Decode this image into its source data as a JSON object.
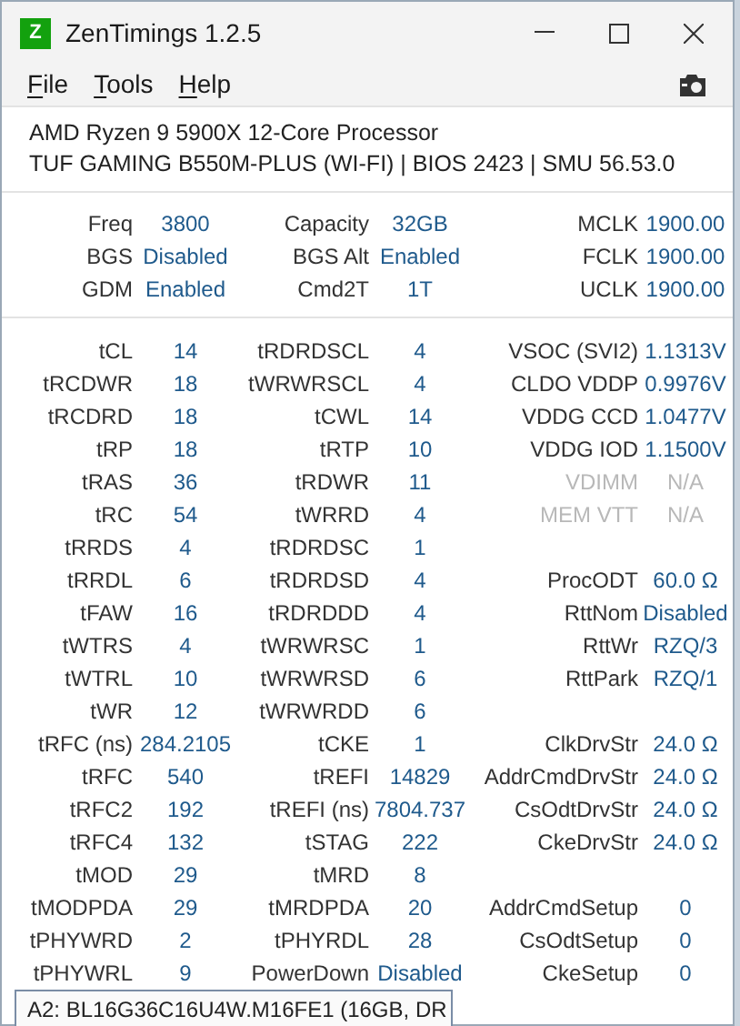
{
  "window": {
    "title": "ZenTimings 1.2.5",
    "logo": "Z"
  },
  "menu": [
    {
      "label": "File"
    },
    {
      "label": "Tools"
    },
    {
      "label": "Help"
    }
  ],
  "system_info": [
    "AMD Ryzen 9 5900X 12-Core Processor",
    "TUF GAMING B550M-PLUS (WI-FI) | BIOS 2423 | SMU 56.53.0"
  ],
  "summary_rows": [
    [
      {
        "label": "Freq",
        "value": "3800"
      },
      {
        "label": "Capacity",
        "value": "32GB"
      },
      {
        "label": "MCLK",
        "value": "1900.00"
      }
    ],
    [
      {
        "label": "BGS",
        "value": "Disabled"
      },
      {
        "label": "BGS Alt",
        "value": "Enabled"
      },
      {
        "label": "FCLK",
        "value": "1900.00"
      }
    ],
    [
      {
        "label": "GDM",
        "value": "Enabled"
      },
      {
        "label": "Cmd2T",
        "value": "1T"
      },
      {
        "label": "UCLK",
        "value": "1900.00"
      }
    ]
  ],
  "timing_rows": [
    [
      {
        "label": "tCL",
        "value": "14"
      },
      {
        "label": "tRDRDSCL",
        "value": "4"
      },
      {
        "label": "VSOC (SVI2)",
        "value": "1.1313V",
        "disabled": false
      }
    ],
    [
      {
        "label": "tRCDWR",
        "value": "18"
      },
      {
        "label": "tWRWRSCL",
        "value": "4"
      },
      {
        "label": "CLDO VDDP",
        "value": "0.9976V",
        "disabled": false
      }
    ],
    [
      {
        "label": "tRCDRD",
        "value": "18"
      },
      {
        "label": "tCWL",
        "value": "14"
      },
      {
        "label": "VDDG CCD",
        "value": "1.0477V",
        "disabled": false
      }
    ],
    [
      {
        "label": "tRP",
        "value": "18"
      },
      {
        "label": "tRTP",
        "value": "10"
      },
      {
        "label": "VDDG IOD",
        "value": "1.1500V",
        "disabled": false
      }
    ],
    [
      {
        "label": "tRAS",
        "value": "36"
      },
      {
        "label": "tRDWR",
        "value": "11"
      },
      {
        "label": "VDIMM",
        "value": "N/A",
        "disabled": true
      }
    ],
    [
      {
        "label": "tRC",
        "value": "54"
      },
      {
        "label": "tWRRD",
        "value": "4"
      },
      {
        "label": "MEM VTT",
        "value": "N/A",
        "disabled": true
      }
    ],
    [
      {
        "label": "tRRDS",
        "value": "4"
      },
      {
        "label": "tRDRDSC",
        "value": "1"
      },
      null
    ],
    [
      {
        "label": "tRRDL",
        "value": "6"
      },
      {
        "label": "tRDRDSD",
        "value": "4"
      },
      {
        "label": "ProcODT",
        "value": "60.0 Ω",
        "disabled": false
      }
    ],
    [
      {
        "label": "tFAW",
        "value": "16"
      },
      {
        "label": "tRDRDDD",
        "value": "4"
      },
      {
        "label": "RttNom",
        "value": "Disabled",
        "disabled": false
      }
    ],
    [
      {
        "label": "tWTRS",
        "value": "4"
      },
      {
        "label": "tWRWRSC",
        "value": "1"
      },
      {
        "label": "RttWr",
        "value": "RZQ/3",
        "disabled": false
      }
    ],
    [
      {
        "label": "tWTRL",
        "value": "10"
      },
      {
        "label": "tWRWRSD",
        "value": "6"
      },
      {
        "label": "RttPark",
        "value": "RZQ/1",
        "disabled": false
      }
    ],
    [
      {
        "label": "tWR",
        "value": "12"
      },
      {
        "label": "tWRWRDD",
        "value": "6"
      },
      null
    ],
    [
      {
        "label": "tRFC (ns)",
        "value": "284.2105"
      },
      {
        "label": "tCKE",
        "value": "1"
      },
      {
        "label": "ClkDrvStr",
        "value": "24.0 Ω",
        "disabled": false
      }
    ],
    [
      {
        "label": "tRFC",
        "value": "540"
      },
      {
        "label": "tREFI",
        "value": "14829"
      },
      {
        "label": "AddrCmdDrvStr",
        "value": "24.0 Ω",
        "disabled": false
      }
    ],
    [
      {
        "label": "tRFC2",
        "value": "192"
      },
      {
        "label": "tREFI (ns)",
        "value": "7804.737"
      },
      {
        "label": "CsOdtDrvStr",
        "value": "24.0 Ω",
        "disabled": false
      }
    ],
    [
      {
        "label": "tRFC4",
        "value": "132"
      },
      {
        "label": "tSTAG",
        "value": "222"
      },
      {
        "label": "CkeDrvStr",
        "value": "24.0 Ω",
        "disabled": false
      }
    ],
    [
      {
        "label": "tMOD",
        "value": "29"
      },
      {
        "label": "tMRD",
        "value": "8"
      },
      null
    ],
    [
      {
        "label": "tMODPDA",
        "value": "29"
      },
      {
        "label": "tMRDPDA",
        "value": "20"
      },
      {
        "label": "AddrCmdSetup",
        "value": "0",
        "disabled": false
      }
    ],
    [
      {
        "label": "tPHYWRD",
        "value": "2"
      },
      {
        "label": "tPHYRDL",
        "value": "28"
      },
      {
        "label": "CsOdtSetup",
        "value": "0",
        "disabled": false
      }
    ],
    [
      {
        "label": "tPHYWRL",
        "value": "9"
      },
      {
        "label": "PowerDown",
        "value": "Disabled"
      },
      {
        "label": "CkeSetup",
        "value": "0",
        "disabled": false
      }
    ]
  ],
  "module_select": {
    "value": "A2: BL16G36C16U4W.M16FE1 (16GB, DR"
  }
}
